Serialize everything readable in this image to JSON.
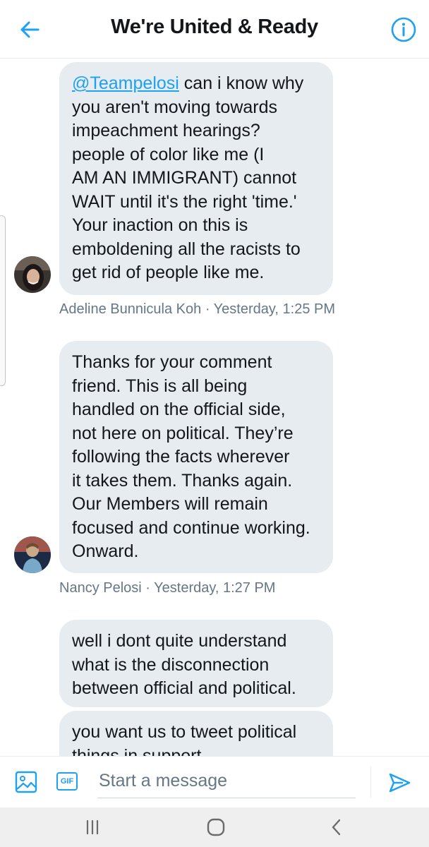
{
  "header": {
    "title": "We're United & Ready",
    "back_icon": "arrow-left-icon",
    "info_icon": "info-circle-icon"
  },
  "messages": [
    {
      "mention": "@Teampelosi",
      "lines": [
        " can i know why",
        "you aren't moving towards",
        "impeachment hearings?",
        "people of color like me (I",
        "AM AN IMMIGRANT) cannot",
        "WAIT until it's the right 'time.'",
        "Your inaction on this is",
        "emboldening all the racists to",
        "get rid of people like me."
      ],
      "meta": "Adeline Bunnicula Koh · Yesterday, 1:25 PM"
    },
    {
      "lines": [
        "Thanks for your comment",
        "friend. This is all being",
        "handled on the official side,",
        "not here on political. They’re",
        "following the facts wherever",
        "it takes them. Thanks again.",
        "Our Members will remain",
        "focused and continue working.",
        "Onward."
      ],
      "meta": "Nancy Pelosi · Yesterday, 1:27 PM"
    },
    {
      "lines": [
        "well i dont quite understand",
        "what is the disconnection",
        "between official and political."
      ]
    },
    {
      "lines": [
        "you want us to tweet political",
        "things in support"
      ]
    }
  ],
  "composer": {
    "placeholder": "Start a message",
    "gif_label": "GIF",
    "media_icon": "image-icon",
    "send_icon": "send-icon"
  },
  "colors": {
    "accent": "#1da1f2",
    "bubble": "#e6ecf0",
    "meta_text": "#657786"
  }
}
